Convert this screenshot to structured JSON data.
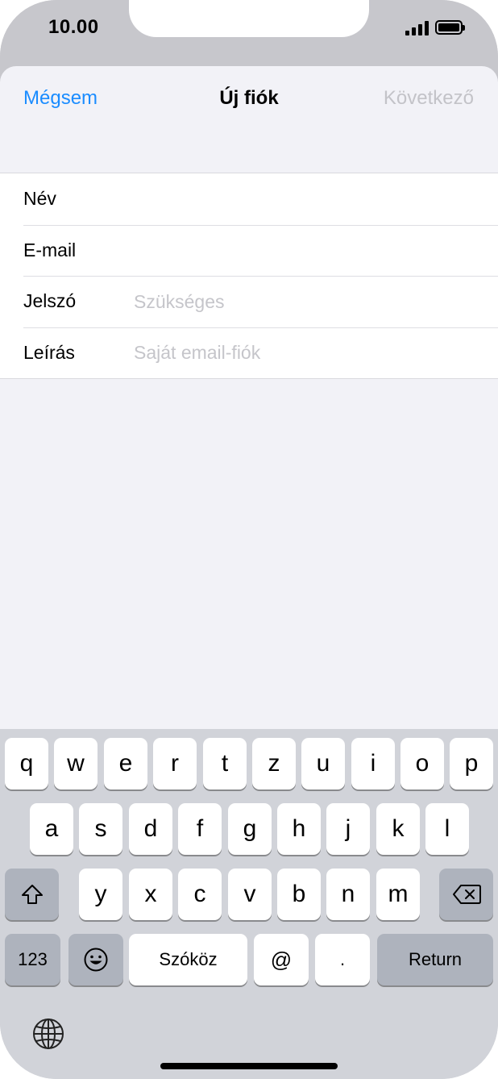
{
  "status_bar": {
    "time": "10.00"
  },
  "nav": {
    "cancel_label": "Mégsem",
    "title": "Új fiók",
    "next_label": "Következő"
  },
  "form": {
    "rows": [
      {
        "label": "Név",
        "placeholder": "",
        "value": ""
      },
      {
        "label": "E-mail",
        "placeholder": "",
        "value": ""
      },
      {
        "label": "Jelszó",
        "placeholder": "Szükséges",
        "value": ""
      },
      {
        "label": "Leírás",
        "placeholder": "Saját email-fiók",
        "value": ""
      }
    ]
  },
  "keyboard": {
    "row1": [
      "q",
      "w",
      "e",
      "r",
      "t",
      "z",
      "u",
      "i",
      "o",
      "p"
    ],
    "row2": [
      "a",
      "s",
      "d",
      "f",
      "g",
      "h",
      "j",
      "k",
      "l"
    ],
    "row3": [
      "y",
      "x",
      "c",
      "v",
      "b",
      "n",
      "m"
    ],
    "numbers_label": "123",
    "space_label": "Szóköz",
    "at_label": "@",
    "dot_label": ".",
    "return_label": "Return"
  },
  "colors": {
    "accent": "#1a8cff",
    "disabled": "#c3c3c8",
    "placeholder": "#c5c5ca"
  },
  "icons": [
    "signal-icon",
    "battery-icon",
    "shift-icon",
    "delete-icon",
    "emoji-icon",
    "globe-icon"
  ]
}
